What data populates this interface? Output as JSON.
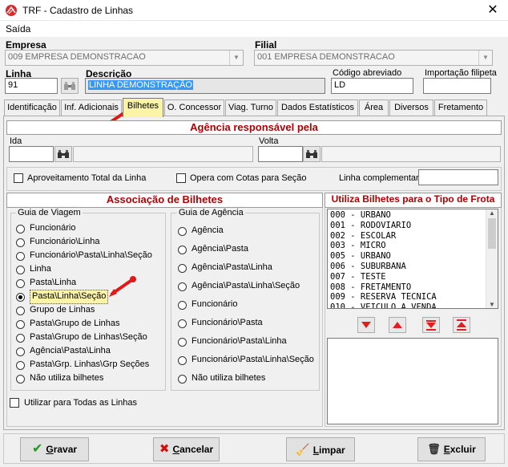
{
  "window": {
    "title": "TRF - Cadastro de Linhas",
    "close": "✕"
  },
  "menu": {
    "saida": "Saída"
  },
  "empresa": {
    "label": "Empresa",
    "value": "009 EMPRESA DEMONSTRACAO"
  },
  "filial": {
    "label": "Filial",
    "value": "001 EMPRESA DEMONSTRACAO"
  },
  "linha": {
    "label": "Linha",
    "value": "91"
  },
  "descricao": {
    "label": "Descrição",
    "value": "LINHA DEMONSTRAÇÃO"
  },
  "codigo": {
    "label": "Código abreviado",
    "value": "LD"
  },
  "importacao": {
    "label": "Importação filipeta",
    "value": ""
  },
  "tabs": [
    "Identificação",
    "Inf. Adicionais",
    "Bilhetes",
    "O. Concessor",
    "Viag. Turno",
    "Dados Estatísticos",
    "Área",
    "Diversos",
    "Fretamento"
  ],
  "agencia": {
    "title": "Agência responsável pela",
    "ida": "Ida",
    "volta": "Volta"
  },
  "options": {
    "aproveitamento": "Aproveitamento Total da Linha",
    "cotas": "Opera com Cotas para Seção",
    "complementar": "Linha complementar"
  },
  "associacao": {
    "title": "Associação de Bilhetes",
    "guia_viagem": "Guia de Viagem",
    "guia_agencia": "Guia de Agência",
    "viagem_items": [
      "Funcionário",
      "Funcionário\\Linha",
      "Funcionário\\Pasta\\Linha\\Seção",
      "Linha",
      "Pasta\\Linha",
      "Pasta\\Linha\\Seção",
      "Grupo de Linhas",
      "Pasta\\Grupo de Linhas",
      "Pasta\\Grupo de Linhas\\Seção",
      "Agência\\Pasta\\Linha",
      "Pasta\\Grp. Linhas\\Grp Seções",
      "Não utiliza bilhetes"
    ],
    "viagem_selected": 5,
    "agencia_items": [
      "Agência",
      "Agência\\Pasta",
      "Agência\\Pasta\\Linha",
      "Agência\\Pasta\\Linha\\Seção",
      "Funcionário",
      "Funcionário\\Pasta",
      "Funcionário\\Pasta\\Linha",
      "Funcionário\\Pasta\\Linha\\Seção",
      "Não utiliza bilhetes"
    ],
    "utilizar_todas": "Utilizar para Todas as Linhas"
  },
  "frota": {
    "title": "Utiliza Bilhetes para o Tipo de Frota",
    "items": [
      "000 - URBANO",
      "001 - RODOVIARIO",
      "002 - ESCOLAR",
      "003 - MICRO",
      "005 - URBANO",
      "006 - SUBURBANA",
      "007 - TESTE",
      "008 - FRETAMENTO",
      "009 - RESERVA TECNICA",
      "010 - VEICULO A VENDA"
    ]
  },
  "buttons": {
    "gravar_u": "G",
    "gravar_rest": "ravar",
    "cancelar_u": "C",
    "cancelar_rest": "ancelar",
    "limpar_u": "L",
    "limpar_rest": "impar",
    "excluir_u": "E",
    "excluir_rest": "xcluir"
  },
  "colors": {
    "section_red": "#b00000",
    "selection_blue": "#3399ff",
    "active_tab": "#fbf4a6"
  }
}
